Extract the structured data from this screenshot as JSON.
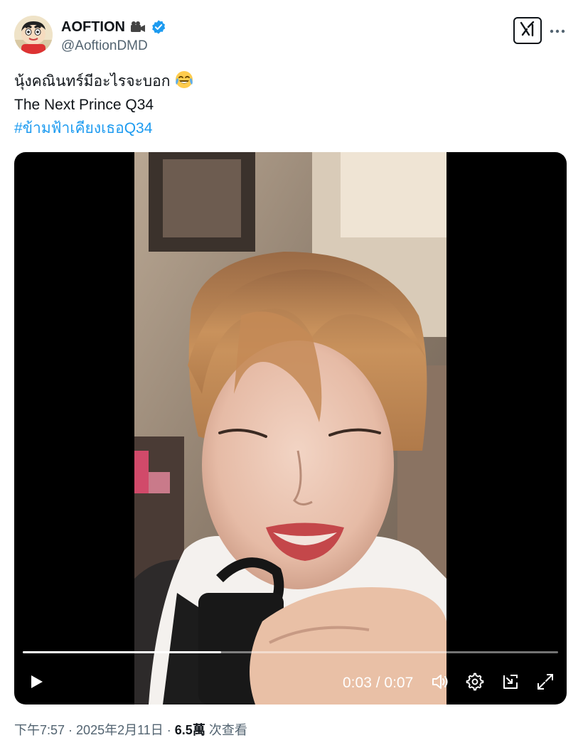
{
  "author": {
    "display_name": "AOFTION",
    "handle": "@AoftionDMD",
    "badge_icon": "video-camera-icon",
    "verified_icon": "verified-badge-icon",
    "verified_color": "#1d9bf0"
  },
  "toolbar": {
    "grok_icon": "grok-icon",
    "more_icon": "more-horizontal-icon"
  },
  "tweet": {
    "line1": "นุ้งคณินทร์มีอะไรจะบอก",
    "line1_emoji": "face-with-tears-of-joy-emoji",
    "line2": "The Next Prince Q34",
    "hashtag": "#ข้ามฟ้าเคียงเธอQ34",
    "hashtag_color": "#1d9bf0"
  },
  "video": {
    "current_time": "0:03",
    "separator": " / ",
    "duration": "0:07",
    "progress_fraction": 0.37,
    "controls": {
      "play_icon": "play-icon",
      "volume_icon": "volume-icon",
      "settings_icon": "gear-icon",
      "pip_icon": "picture-in-picture-icon",
      "fullscreen_icon": "fullscreen-icon"
    }
  },
  "footer": {
    "time": "下午7:57",
    "dot1": " · ",
    "date": "2025年2月11日",
    "dot2": " · ",
    "views_count": "6.5萬",
    "views_label": " 次查看"
  }
}
